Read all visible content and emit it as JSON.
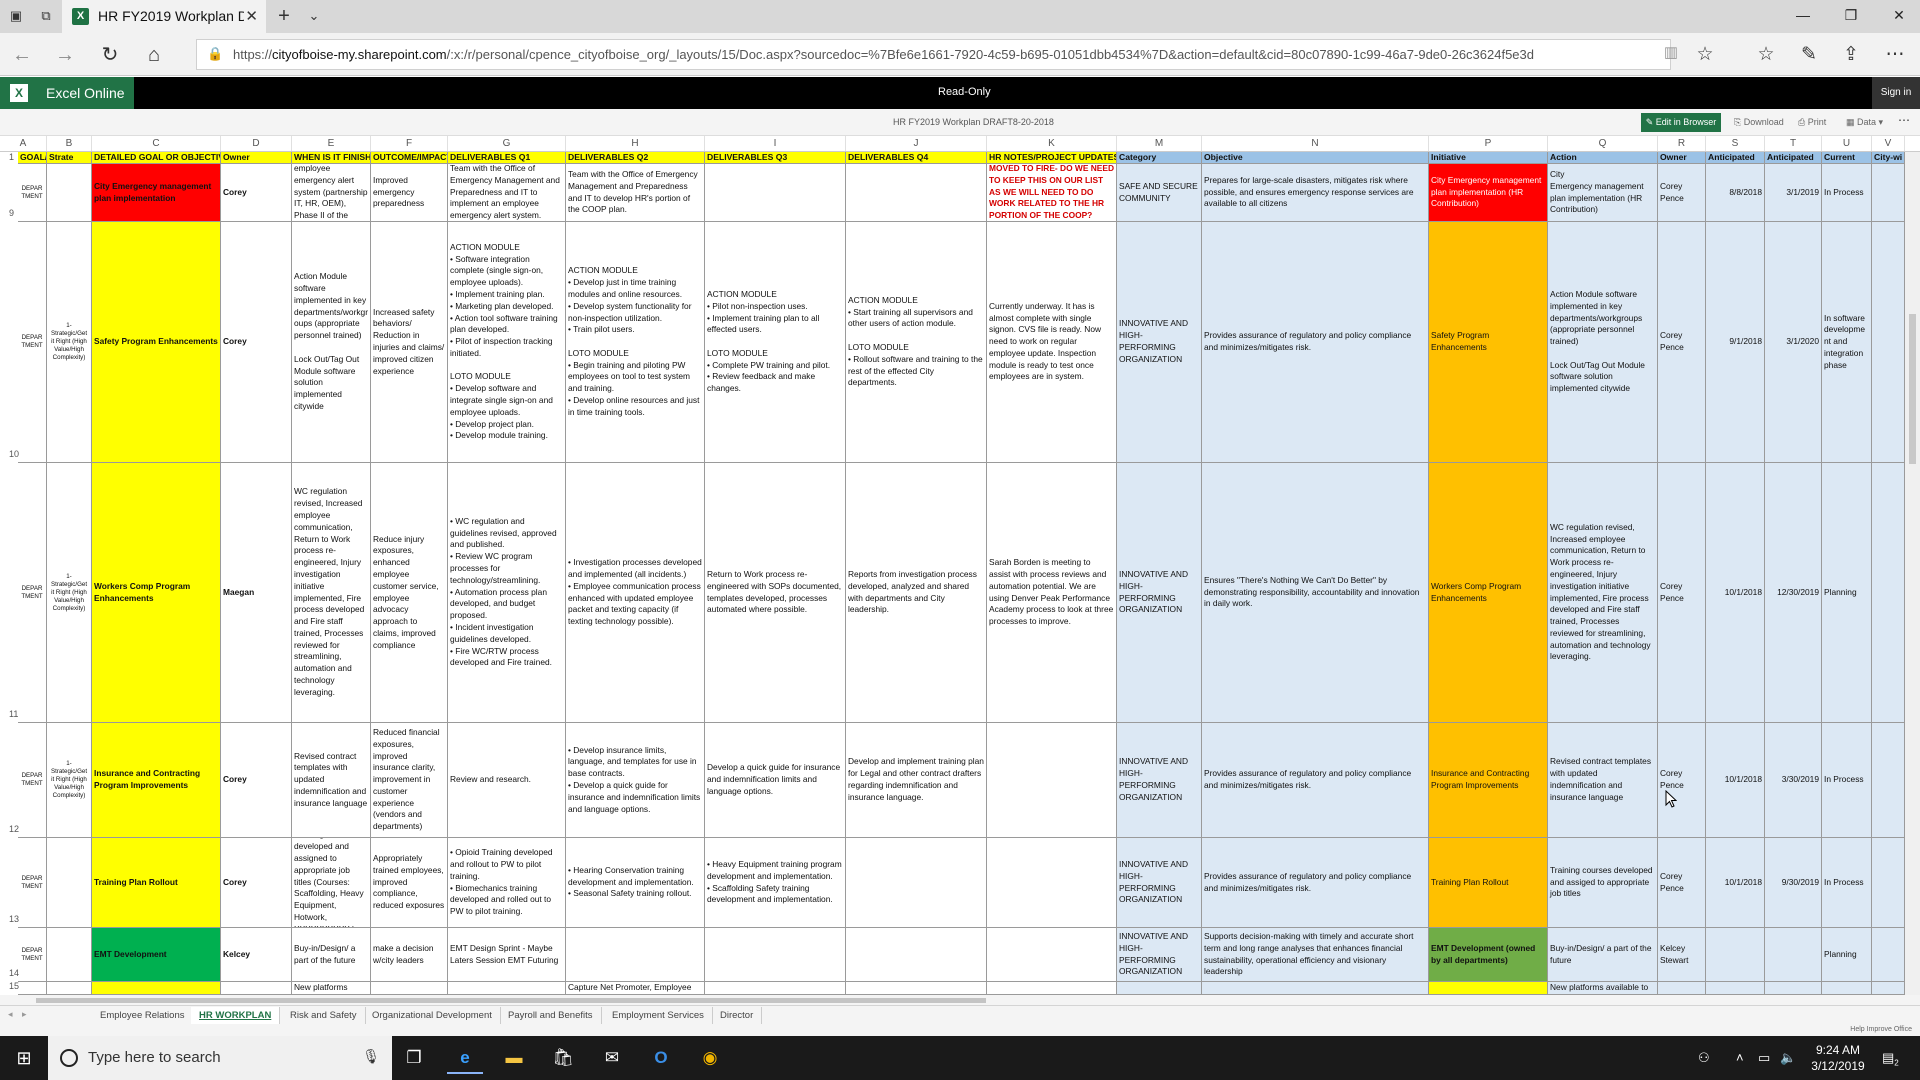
{
  "browser": {
    "tab_title": "HR FY2019 Workplan DI",
    "url_prefix": "https://",
    "url_domain": "cityofboise-my.sharepoint.com",
    "url_path": "/:x:/r/personal/cpence_cityofboise_org/_layouts/15/Doc.aspx?sourcedoc=%7Bfe6e1661-7920-4c59-b695-01051dbb4534%7D&action=default&cid=80c07890-1c99-46a7-9de0-26c3624f5e3d"
  },
  "excel": {
    "app_name": "Excel Online",
    "mode": "Read-Only",
    "signin": "Sign in",
    "doc_title": "HR FY2019 Workplan DRAFT8-20-2018",
    "edit_in_browser": "Edit in Browser",
    "download": "Download",
    "print": "Print",
    "data": "Data"
  },
  "columns": [
    "A",
    "B",
    "C",
    "D",
    "E",
    "F",
    "G",
    "H",
    "I",
    "J",
    "K",
    "M",
    "N",
    "",
    "P",
    "Q",
    "R",
    "S",
    "T",
    "U",
    "V"
  ],
  "header_row": {
    "num": "1",
    "cells": [
      "GOAL/",
      "Strate",
      "DETAILED GOAL OR OBJECTIVE",
      "Owner",
      "WHEN IS IT FINISHED?",
      "OUTCOME/IMPACT",
      "DELIVERABLES Q1",
      "DELIVERABLES Q2",
      "DELIVERABLES Q3",
      "DELIVERABLES Q4",
      "HR NOTES/PROJECT UPDATES",
      "Category",
      "Objective",
      "Initiative",
      "Action",
      "Owner",
      "Anticipated",
      "Anticipated",
      "Current",
      "City-wi"
    ]
  },
  "rows": [
    {
      "num": "9",
      "a": "DEPARTMENT",
      "b": "",
      "c": "City Emergency management plan implementation",
      "d": "Corey",
      "e": "implementation of employee emergency alert system (partnership IT, HR, OEM), Phase II of the COOP",
      "f": "Improved emergency preparedness",
      "g": "Team with the Office of Emergency Management and Preparedness and IT to implement an employee emergency alert system.",
      "h": "Team with the Office of Emergency Management and Preparedness and IT to develop HR's portion of the COOP plan.",
      "i": "",
      "j": "",
      "k": "MOVED TO FIRE- DO WE NEED TO KEEP THIS ON OUR LIST AS WE WILL NEED TO DO WORK RELATED TO THE HR PORTION OF THE COOP?",
      "m": "SAFE AND SECURE COMMUNITY",
      "n": "Prepares for large-scale disasters, mitigates risk where possible, and ensures emergency response services are available to all citizens",
      "p": "City Emergency management plan implementation (HR Contribution)",
      "q": "City\nEmergency management plan implementation (HR Contribution)",
      "r": "Corey Pence",
      "s": "8/8/2018",
      "t": "3/1/2019",
      "u": "In Process"
    },
    {
      "num": "10",
      "a": "DEPARTMENT",
      "b": "1-Strategic/Get it Right (High Value/High Complexity)",
      "c": "Safety Program Enhancements",
      "d": "Corey",
      "e": "Action Module software implemented in key departments/workgroups (appropriate personnel trained)\n\nLock Out/Tag Out Module software solution implemented citywide",
      "f": "Increased safety behaviors/ Reduction in injuries and claims/ improved citizen experience",
      "g": "ACTION MODULE\n• Software integration complete (single sign-on, employee uploads).\n• Implement training plan.\n• Marketing plan developed.\n• Action tool software training plan developed.\n• Pilot of inspection tracking initiated.\n\nLOTO MODULE\n• Develop software and integrate single sign-on and employee uploads.\n• Develop project plan.\n• Develop module training.",
      "h": "ACTION MODULE\n• Develop just in time training modules and online resources.\n• Develop system functionality for non-inspection utilization.\n• Train pilot users.\n\nLOTO MODULE\n• Begin training and piloting PW employees on tool to test system and training.\n• Develop online resources and just in time training tools.",
      "i": "ACTION MODULE\n• Pilot non-inspection uses.\n• Implement training plan to all effected users.\n\nLOTO MODULE\n• Complete PW training and pilot.\n• Review feedback and make changes.",
      "j": "ACTION MODULE\n• Start training all supervisors and other users of action module.\n\nLOTO MODULE\n• Rollout software and training to the rest of the effected City departments.",
      "k": "Currently underway. It has is almost complete with single signon. CVS file is ready. Now need to work on regular employee update. Inspection module is ready to test once employees are in system.",
      "m": "INNOVATIVE AND HIGH-PERFORMING ORGANIZATION",
      "n": "Provides assurance of regulatory and policy compliance and minimizes/mitigates risk.",
      "p": "Safety Program Enhancements",
      "q": "Action Module software implemented in key departments/workgroups (appropriate personnel trained)\n\nLock Out/Tag Out Module software solution implemented citywide",
      "r": "Corey Pence",
      "s": "9/1/2018",
      "t": "3/1/2020",
      "u": "In software development and integration phase"
    },
    {
      "num": "11",
      "a": "DEPARTMENT",
      "b": "1-Strategic/Get it Right (High Value/High Complexity)",
      "c": "Workers Comp Program Enhancements",
      "d": "Maegan",
      "e": "WC regulation revised, Increased employee communication, Return to Work process re-engineered, Injury investigation initiative implemented, Fire process developed and Fire staff trained, Processes reviewed for streamlining, automation and technology leveraging.",
      "f": "Reduce injury exposures, enhanced employee customer service, employee advocacy approach to claims, improved compliance",
      "g": "• WC regulation and guidelines revised, approved and published.\n• Review WC program processes for technology/streamlining.\n• Automation process plan developed, and budget proposed.\n• Incident investigation guidelines developed.\n• Fire WC/RTW process developed and Fire trained.",
      "h": "• Investigation processes developed and implemented (all incidents.)\n• Employee communication process enhanced with updated employee packet and texting capacity (if texting technology possible).",
      "i": "Return to Work process re-engineered with SOPs documented, templates developed, processes automated where possible.",
      "j": "Reports from investigation process developed, analyzed and shared with departments and City leadership.",
      "k": "Sarah Borden is meeting to assist with process reviews and automation potential. We are using Denver Peak Performance Academy process to look at three processes to improve.",
      "m": "INNOVATIVE AND HIGH-PERFORMING ORGANIZATION",
      "n": "Ensures \"There's Nothing We Can't Do Better\" by demonstrating responsibility, accountability and innovation in daily work.",
      "p": "Workers Comp Program Enhancements",
      "q": "WC regulation revised, Increased employee communication, Return to Work process re-engineered, Injury investigation initiative implemented, Fire process developed and Fire staff trained, Processes reviewed for streamlining, automation and technology leveraging.",
      "r": "Corey Pence",
      "s": "10/1/2018",
      "t": "12/30/2019",
      "u": "Planning"
    },
    {
      "num": "12",
      "a": "DEPARTMENT",
      "b": "1-Strategic/Get it Right (High Value/High Complexity)",
      "c": "Insurance and Contracting Program Improvements",
      "d": "Corey",
      "e": "Revised contract templates with updated indemnification and insurance language",
      "f": "Reduced financial exposures, improved insurance clarity, improvement in customer experience (vendors and departments)",
      "g": "Review and research.",
      "h": "• Develop insurance limits, language, and templates for use in base contracts.\n• Develop a quick guide for insurance and indemnification limits and language options.",
      "i": "Develop a quick guide for insurance and indemnification limits and language options.",
      "j": "Develop and implement training plan for Legal and other contract drafters regarding indemnification and insurance language.",
      "k": "",
      "m": "INNOVATIVE AND HIGH-PERFORMING ORGANIZATION",
      "n": "Provides assurance of regulatory and policy compliance and minimizes/mitigates risk.",
      "p": "Insurance and Contracting Program Improvements",
      "q": "Revised contract templates with updated indemnification and insurance language",
      "r": "Corey Pence",
      "s": "10/1/2018",
      "t": "3/30/2019",
      "u": "In Process"
    },
    {
      "num": "13",
      "a": "DEPARTMENT",
      "b": "",
      "c": "Training Plan Rollout",
      "d": "Corey",
      "e": "Training courses developed and assigned to appropriate job titles (Courses: Scaffolding, Heavy Equipment, Hotwork, XXXXXXXXXX )",
      "f": "Appropriately trained employees, improved compliance, reduced exposures",
      "g": "• Opioid Training developed and rollout to PW to pilot training.\n• Biomechanics training developed and rolled out to PW to pilot training.",
      "h": "• Hearing Conservation training development and implementation.\n• Seasonal Safety training rollout.",
      "i": "• Heavy Equipment training program development and implementation.\n• Scaffolding Safety training development and implementation.",
      "j": "",
      "k": "",
      "m": "INNOVATIVE AND HIGH-PERFORMING ORGANIZATION",
      "n": "Provides assurance of regulatory and policy compliance and minimizes/mitigates risk.",
      "p": "Training Plan Rollout",
      "q": "Training courses developed and assiged to appropriate job titles",
      "r": "Corey Pence",
      "s": "10/1/2018",
      "t": "9/30/2019",
      "u": "In Process"
    },
    {
      "num": "14",
      "a": "DEPARTMENT",
      "b": "",
      "c": "EMT Development",
      "d": "Kelcey",
      "e": "Buy-in/Design/ a part of the future",
      "f": "make a decision w/city leaders",
      "g": "EMT Design Sprint - Maybe Laters Session EMT Futuring",
      "h": "",
      "i": "",
      "j": "",
      "k": "",
      "m": "INNOVATIVE AND HIGH-PERFORMING ORGANIZATION",
      "n": "Supports decision-making with timely and accurate short term and long range analyses that enhances financial sustainability, operational efficiency and visionary leadership",
      "p": "EMT Development (owned by all departments)",
      "q": "Buy-in/Design/ a part of the future",
      "r": "Kelcey Stewart",
      "s": "",
      "t": "",
      "u": "Planning"
    },
    {
      "num": "15",
      "a": "",
      "b": "",
      "c": "",
      "d": "",
      "e": "New platforms available",
      "f": "",
      "g": "",
      "h": "Capture Net Promoter, Employee",
      "i": "",
      "j": "",
      "k": "",
      "m": "",
      "n": "",
      "p": "",
      "q": "New platforms available to",
      "r": "",
      "s": "",
      "t": "",
      "u": ""
    }
  ],
  "sheet_tabs": [
    "Employee Relations",
    "HR WORKPLAN",
    "Risk and Safety",
    "Organizational Development",
    "Payroll and Benefits",
    "Employment Services",
    "Director"
  ],
  "active_sheet": "HR WORKPLAN",
  "status": {
    "help": "Help Improve Office"
  },
  "taskbar": {
    "search_placeholder": "Type here to search",
    "time": "9:24 AM",
    "date": "3/12/2019",
    "notification_count": "2"
  },
  "colors": {
    "red": "#ff0000",
    "yellow": "#ffff00",
    "green": "#00b050",
    "light_green": "#70ad47",
    "orange": "#ffc000",
    "light_blue": "#dce8f4",
    "header_blue": "#9bc2e6",
    "excel_green": "#217346"
  }
}
